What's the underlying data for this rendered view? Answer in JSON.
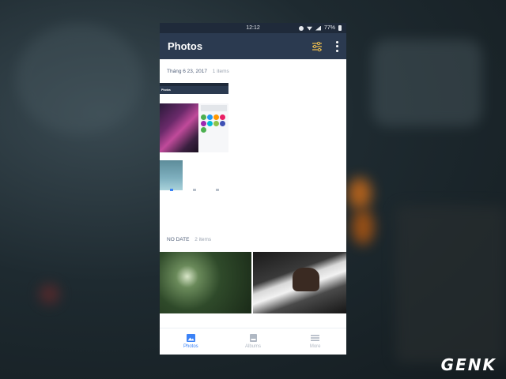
{
  "status_bar": {
    "time": "12:12",
    "battery": "77%"
  },
  "app_bar": {
    "title": "Photos"
  },
  "sections": [
    {
      "date": "Tháng 6 23, 2017",
      "count": "1 items"
    },
    {
      "date": "NO DATE",
      "count": "2 items"
    }
  ],
  "mini_screenshot": {
    "title": "Photos"
  },
  "bottom_nav": [
    {
      "label": "Photos",
      "icon": "image-icon",
      "active": true
    },
    {
      "label": "Albums",
      "icon": "album-icon",
      "active": false
    },
    {
      "label": "More",
      "icon": "menu-icon",
      "active": false
    }
  ],
  "colors": {
    "app_bar": "#2b3a50",
    "status_bar": "#1f2a3a",
    "accent": "#3b82f6"
  },
  "watermark": "GENK"
}
